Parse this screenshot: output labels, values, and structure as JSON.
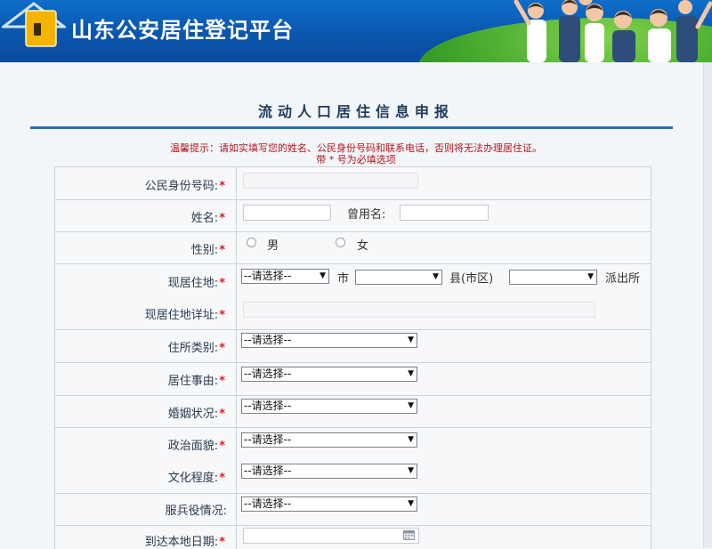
{
  "header": {
    "title": "山东公安居住登记平台"
  },
  "page": {
    "heading": "流动人口居住信息申报",
    "notice_line1": "温馨提示：请如实填写您的姓名、公民身份号码和联系电话，否则将无法办理居住证。",
    "notice_line2": "带 * 号为必填选项"
  },
  "form": {
    "required_mark": "*",
    "id_number": {
      "label": "公民身份号码:",
      "value": ""
    },
    "name": {
      "label": "姓名:",
      "value": ""
    },
    "former_name": {
      "label": "曾用名:",
      "value": ""
    },
    "gender": {
      "label": "性别:",
      "options": [
        "男",
        "女"
      ]
    },
    "residence": {
      "label": "现居住地:",
      "province_select": "--请选择--",
      "city_unit": "市",
      "county_unit": "县(市区)",
      "police_unit": "派出所"
    },
    "residence_detail": {
      "label": "现居住地详址:",
      "value": ""
    },
    "dwelling_type": {
      "label": "住所类别:",
      "selected": "--请选择--"
    },
    "residence_reason": {
      "label": "居住事由:",
      "selected": "--请选择--"
    },
    "marital_status": {
      "label": "婚姻状况:",
      "selected": "--请选择--"
    },
    "political_status": {
      "label": "政治面貌:",
      "selected": "--请选择--"
    },
    "education": {
      "label": "文化程度:",
      "selected": "--请选择--"
    },
    "military_service": {
      "label": "服兵役情况:",
      "selected": "--请选择--"
    },
    "arrival_date": {
      "label": "到达本地日期:",
      "value": ""
    }
  },
  "colors": {
    "header_blue": "#0a55ad",
    "accent_rule": "#2d6fb5",
    "required_red": "#d4202a",
    "notice_red": "#b0161c"
  }
}
